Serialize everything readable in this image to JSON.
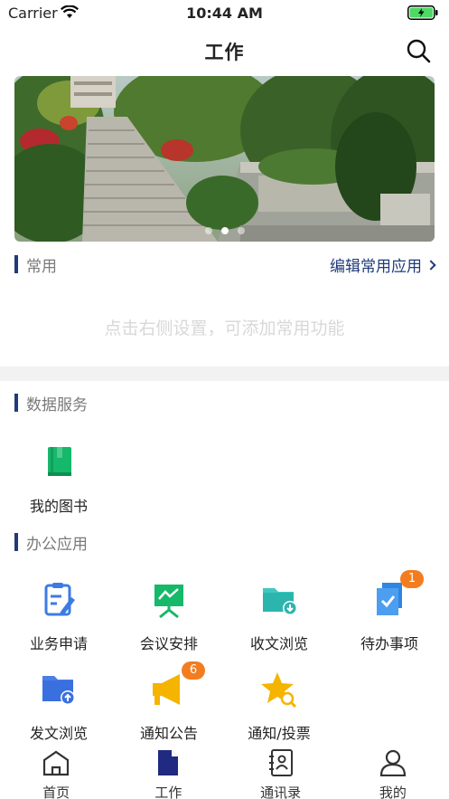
{
  "status": {
    "carrier": "Carrier",
    "time": "10:44 AM"
  },
  "header": {
    "title": "工作"
  },
  "banner": {
    "dots": 3,
    "active_dot": 1
  },
  "common": {
    "title": "常用",
    "edit_label": "编辑常用应用",
    "empty_hint": "点击右侧设置，可添加常用功能"
  },
  "data_services": {
    "title": "数据服务",
    "items": [
      {
        "label": "我的图书",
        "icon": "book-icon"
      }
    ]
  },
  "office_apps": {
    "title": "办公应用",
    "items": [
      {
        "label": "业务申请",
        "icon": "edit-document-icon"
      },
      {
        "label": "会议安排",
        "icon": "presentation-board-icon"
      },
      {
        "label": "收文浏览",
        "icon": "folder-download-icon"
      },
      {
        "label": "待办事项",
        "icon": "todo-check-icon",
        "badge": "1"
      },
      {
        "label": "发文浏览",
        "icon": "folder-upload-icon"
      },
      {
        "label": "通知公告",
        "icon": "megaphone-icon",
        "badge": "6"
      },
      {
        "label": "通知/投票",
        "icon": "star-search-icon"
      }
    ]
  },
  "tabbar": {
    "items": [
      {
        "label": "首页",
        "icon": "home-icon"
      },
      {
        "label": "工作",
        "icon": "work-document-icon",
        "active": true
      },
      {
        "label": "通讯录",
        "icon": "contacts-icon"
      },
      {
        "label": "我的",
        "icon": "profile-icon"
      }
    ]
  },
  "colors": {
    "accent": "#1f3b7a",
    "badge": "#f47c20",
    "divider": "#f2f2f2",
    "hint": "#d8d8d8"
  }
}
